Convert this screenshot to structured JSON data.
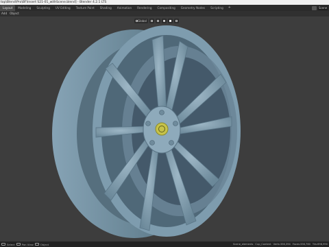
{
  "window": {
    "title": "top\\Blend\\Pro\\BF\\Insert S21-01_withScene.blend] - Blender 4.2.1 LTS"
  },
  "workspaces": {
    "tabs": [
      "Layout",
      "Modeling",
      "Sculpting",
      "UV Editing",
      "Texture Paint",
      "Shading",
      "Animation",
      "Rendering",
      "Compositing",
      "Geometry Nodes",
      "Scripting"
    ],
    "active": "Layout",
    "add_label": "+",
    "scene_label": "Scene"
  },
  "header": {
    "menu_items": [
      "Add",
      "Object"
    ]
  },
  "viewport_toolbar": {
    "transform_orientation": "Global",
    "icons": [
      "orientation-icon",
      "pivot-icon",
      "snap-icon",
      "proportional-icon",
      "shading-solid-icon",
      "overlay-icon"
    ]
  },
  "statusbar": {
    "left_labels": [
      "Select",
      "Pan View",
      "Object"
    ],
    "items": [
      "Scene_elements",
      "Cup_Content",
      "Verts:356,394",
      "Faces:356,760",
      "Tris:698,990"
    ]
  },
  "colors": {
    "wheel_body": "#7e9cae",
    "wheel_shadow": "#4f6878",
    "wheel_highlight": "#a9c1cf",
    "center_cap": "#c6c24a",
    "viewport_bg": "#3d3d3d"
  }
}
